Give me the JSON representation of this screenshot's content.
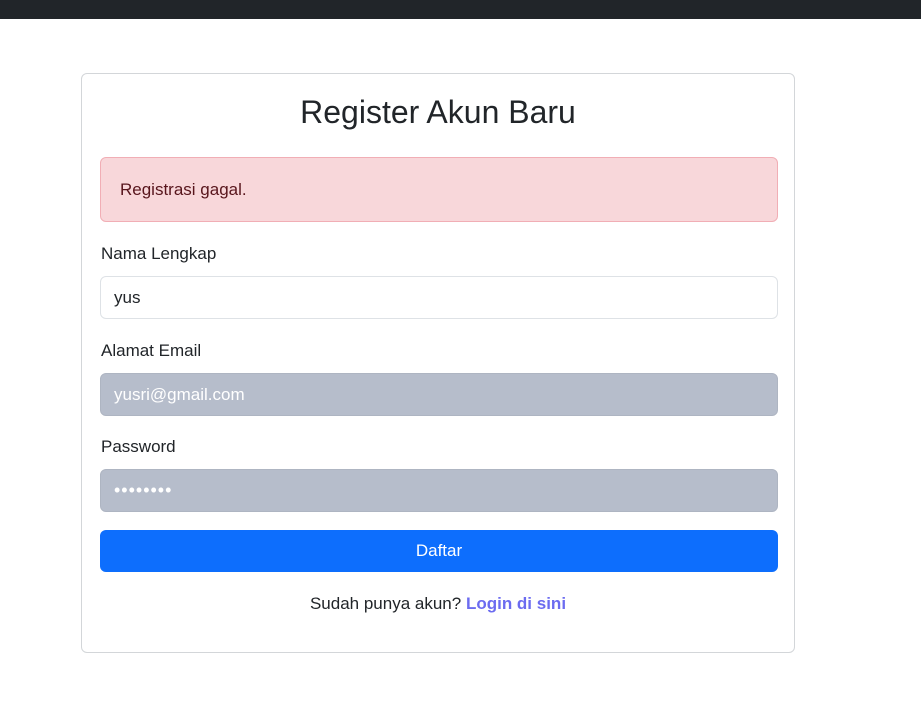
{
  "form": {
    "title": "Register Akun Baru",
    "alert_message": "Registrasi gagal.",
    "name_label": "Nama Lengkap",
    "name_value": "yus",
    "email_label": "Alamat Email",
    "email_value": "yusri@gmail.com",
    "password_label": "Password",
    "password_value": "••••••••",
    "submit_label": "Daftar",
    "footer_text": "Sudah punya akun?",
    "login_link_label": "Login di sini"
  },
  "colors": {
    "topbar": "#212529",
    "alert_background": "#f8d7da",
    "alert_text": "#58151c",
    "button_primary": "#0d6efd",
    "autofill_field": "#b6bdcb",
    "link": "#6c6cf0"
  }
}
